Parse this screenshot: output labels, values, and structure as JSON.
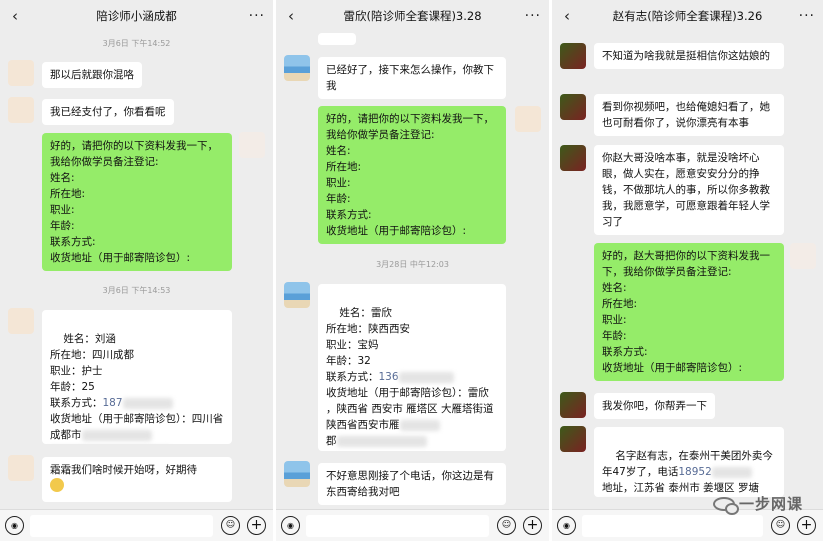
{
  "panel1": {
    "title": "陪诊师小涵成都",
    "ts1": "3月6日 下午14:52",
    "msg1": "那以后就跟你混咯",
    "msg2": "我已经支付了，你看看呢",
    "msg3": "好的，请把你的以下资料发我一下，我给你做学员备注登记:\n姓名:\n所在地:\n职业:\n年龄:\n联系方式:\n收货地址（用于邮寄陪诊包）:",
    "ts2": "3月6日 下午14:53",
    "msg4_text": "姓名：刘涵\n所在地：四川成都\n职业：护士\n年龄：25\n联系方式：",
    "msg4_phone": "187",
    "msg4_addr": "收货地址（用于邮寄陪诊包）：四川省成都市",
    "msg5": "霜霜我们啥时候开始呀，好期待"
  },
  "panel2": {
    "title": "雷欣(陪诊师全套课程)3.28",
    "msg1": "已经好了，接下来怎么操作，你教下我",
    "msg2": "好的，请把你的以下资料发我一下，我给你做学员备注登记:\n姓名:\n所在地:\n职业:\n年龄:\n联系方式:\n收货地址（用于邮寄陪诊包）:",
    "ts1": "3月28日 中午12:03",
    "msg3_text": "姓名：雷欣\n所在地：陕西西安\n职业：宝妈\n年龄：32\n联系方式：",
    "msg3_phone": "136",
    "msg3_addr": "收货地址（用于邮寄陪诊包）：雷欣\n，陕西省 西安市 雁塔区 大雁塔街道 陕西省西安市雁",
    "msg3_tail": "郡",
    "msg4": "不好意思刚接了个电话，你这边是有东西寄给我对吧"
  },
  "panel3": {
    "title": "赵有志(陪诊师全套课程)3.26",
    "msg1": "不知道为啥我就是挺相信你这姑娘的",
    "msg2": "看到你视频吧，也给俺媳妇看了，她也可耐看你了，说你漂亮有本事",
    "msg3": "你赵大哥没啥本事，就是没啥坏心眼，做人实在，愿意安安分分的挣钱，不做那坑人的事，所以你多教教我，我愿意学，可愿意跟着年轻人学习了",
    "msg4": "好的，赵大哥把你的以下资料发我一下，我给你做学员备注登记:\n姓名:\n所在地:\n职业:\n年龄:\n联系方式:\n收货地址（用于邮寄陪诊包）:",
    "msg5": "我发你吧，你帮弄一下",
    "msg6_a": "名字赵有志，在泰州干美团外卖今年47岁了，电话",
    "msg6_phone": "18952",
    "msg6_b": "地址，江苏省 泰州市 姜堰区 罗塘"
  },
  "watermark": "一步网课",
  "icons": {
    "back": "‹",
    "more": "···",
    "voice": "◉",
    "emoji": "☺",
    "plus": "+"
  }
}
